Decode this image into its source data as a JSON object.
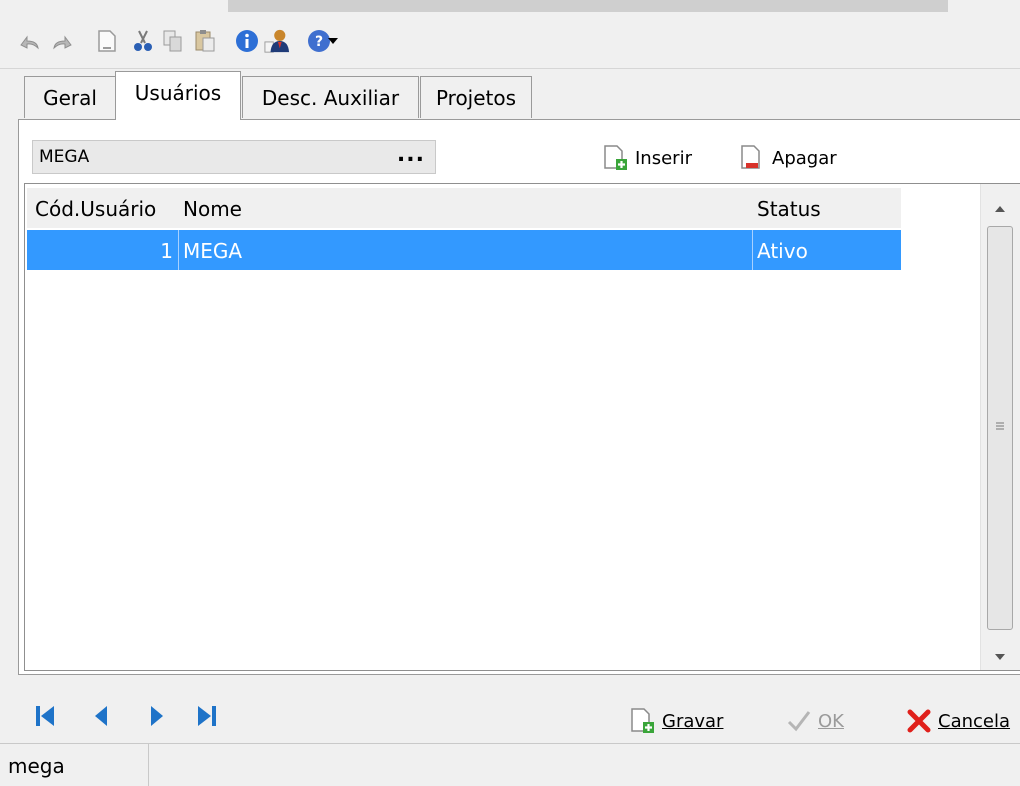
{
  "toolbar": {
    "icons": [
      "undo-icon",
      "redo-icon",
      "new-document-icon",
      "cut-icon",
      "copy-icon",
      "paste-icon",
      "info-icon",
      "user-icon",
      "help-icon",
      "dropdown-arrow-icon"
    ]
  },
  "tabs": [
    {
      "label": "Geral",
      "active": false
    },
    {
      "label": "Usuários",
      "active": true
    },
    {
      "label": "Desc. Auxiliar",
      "active": false
    },
    {
      "label": "Projetos",
      "active": false
    }
  ],
  "user_selector": {
    "value": "MEGA",
    "button_label": "..."
  },
  "actions": {
    "insert_label": "Inserir",
    "delete_label": "Apagar"
  },
  "grid": {
    "columns": [
      "Cód.Usuário",
      "Nome",
      "Status"
    ],
    "rows": [
      {
        "code": "1",
        "name": "MEGA",
        "status": "Ativo",
        "selected": true
      }
    ]
  },
  "footer": {
    "save_label": "Gravar",
    "ok_label": "OK",
    "cancel_label": "Cancela"
  },
  "status_bar": {
    "user": "mega"
  },
  "colors": {
    "selection": "#3399ff",
    "nav_arrows": "#1e73c8",
    "cancel_red": "#e0201b",
    "insert_green": "#3aa53a"
  }
}
